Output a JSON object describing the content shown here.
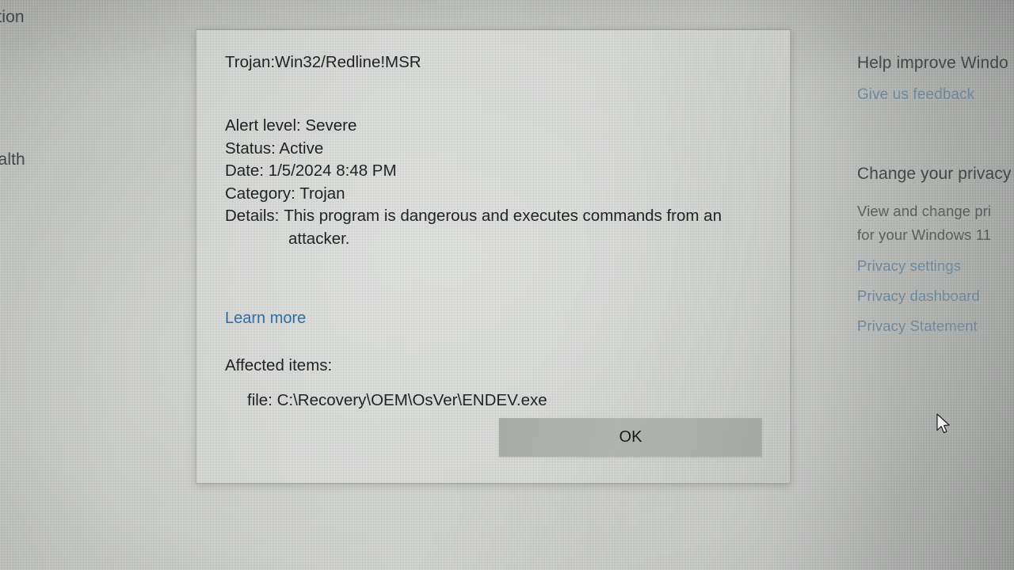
{
  "dialog": {
    "threat_name": "Trojan:Win32/Redline!MSR",
    "details": [
      {
        "label": "Alert level:",
        "value": "Severe"
      },
      {
        "label": "Status:",
        "value": "Active"
      },
      {
        "label": "Date:",
        "value": "1/5/2024 8:48 PM"
      },
      {
        "label": "Category:",
        "value": "Trojan"
      },
      {
        "label": "Details:",
        "value": "This program is dangerous and executes commands from an attacker."
      }
    ],
    "learn_more_label": "Learn more",
    "affected_items_label": "Affected items:",
    "affected_item": "file: C:\\Recovery\\OEM\\OsVer\\ENDEV.exe",
    "ok_label": "OK",
    "link_color": "#2f6ea5",
    "button_color": "#a8aba6",
    "surface_color": "#d4d7d3"
  },
  "background": {
    "left_clipped": [
      {
        "text": "ection"
      },
      {
        "text": "health"
      }
    ],
    "right_panel": [
      {
        "text": "Help improve Windo"
      },
      {
        "text": "Give us feedback"
      },
      {
        "text": "Change your privacy"
      },
      {
        "text": "View and change pri"
      },
      {
        "text": "for your Windows 11"
      },
      {
        "text": "Privacy settings"
      },
      {
        "text": "Privacy dashboard"
      },
      {
        "text": "Privacy Statement"
      }
    ],
    "surface_color": "#c5c8c4",
    "link_color": "#6f8a9c"
  },
  "cursor": {
    "icon": "arrow-pointer"
  }
}
